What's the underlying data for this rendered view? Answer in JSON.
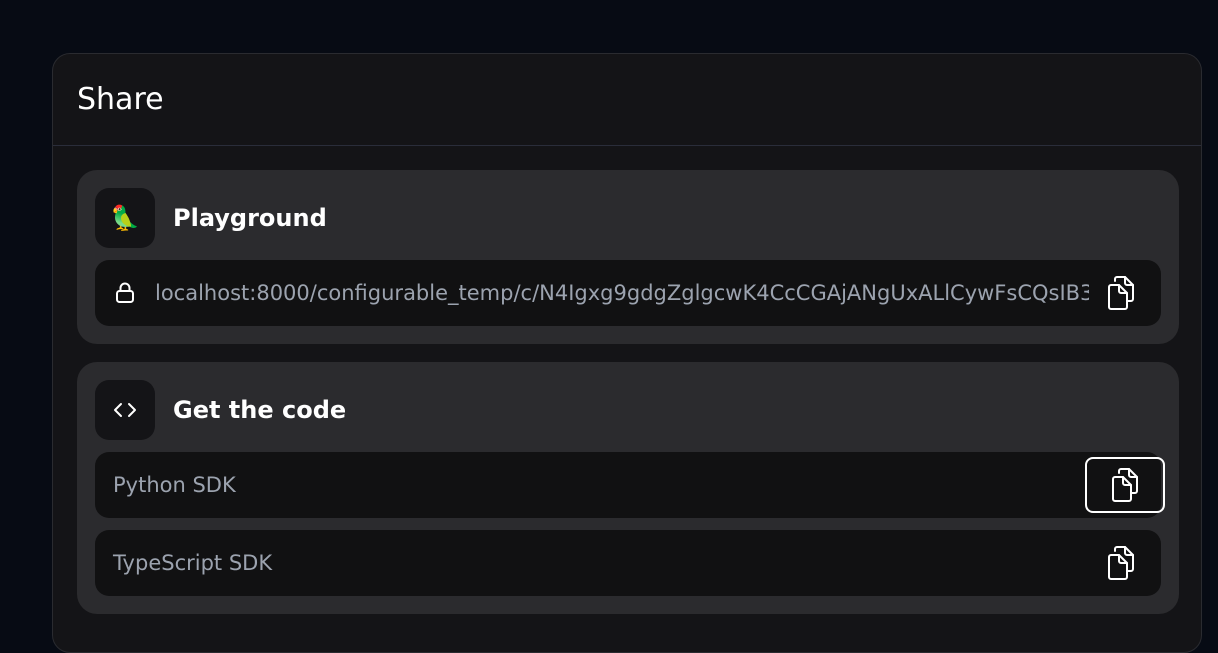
{
  "dialog": {
    "title": "Share"
  },
  "playground": {
    "title": "Playground",
    "icon": "parrot-icon",
    "icon_glyph": "🦜",
    "url": "localhost:8000/configurable_temp/c/N4Igxg9gdgZglgcwK4CcCGAjANgUxALlCywFsCQsIB3"
  },
  "code": {
    "title": "Get the code",
    "icon": "code-icon",
    "options": [
      {
        "label": "Python SDK"
      },
      {
        "label": "TypeScript SDK"
      }
    ]
  },
  "colors": {
    "background": "#070b14",
    "dialog": "#141417",
    "card": "#2b2b2e",
    "row": "#111112",
    "muted_text": "#9ca3af"
  }
}
